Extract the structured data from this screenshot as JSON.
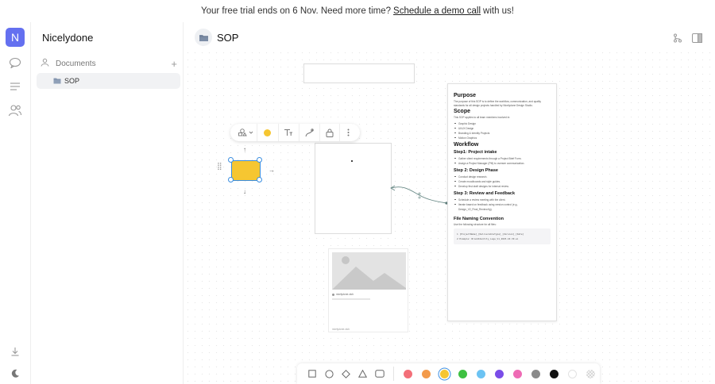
{
  "banner": {
    "prefix": "Your free trial ends on 6 Nov. Need more time?",
    "link": "Schedule a demo call",
    "suffix": "with us!"
  },
  "rail": {
    "logo_letter": "N",
    "icons": [
      "chat-icon",
      "menu-lines-icon",
      "people-icon",
      "download-icon",
      "moon-icon"
    ]
  },
  "sidebar": {
    "workspace_name": "Nicelydone",
    "section_label": "Documents",
    "items": [
      {
        "label": "SOP"
      }
    ]
  },
  "document": {
    "title": "SOP",
    "toolbar_icons": [
      "shapes-icon",
      "chevron-down-icon",
      "color-swatch",
      "text-format-icon",
      "connector-icon",
      "lock-icon",
      "more-vertical-icon"
    ]
  },
  "sop_card": {
    "purpose_heading": "Purpose",
    "purpose_text": "The purpose of this SOP is to define the workflow, communication, and quality standards for all design projects handled by Nicelydone Design Studio.",
    "scope_heading": "Scope",
    "scope_text": "This SOP applies to all team members involved in:",
    "scope_items": [
      "Graphic Design",
      "UI/UX Design",
      "Branding & Identity Projects",
      "Motion Graphics"
    ],
    "workflow_heading": "Workflow",
    "step1_heading": "Step1: Project intake",
    "step1_items": [
      "Gather client requirements through a Project Brief Form.",
      "Assign a Project Manager (PM) to oversee communication."
    ],
    "step2_heading": "Step 2: Design Phase",
    "step2_items": [
      "Conduct design research.",
      "Create moodboards and style guides.",
      "Develop first draft designs for internal review."
    ],
    "step3_heading": "Step 3: Review and Feedback",
    "step3_items": [
      "Schedule a review meeting with the client.",
      "Iterate based on feedback using version control (e.g., Design_V2_Final_Review.fig)."
    ],
    "naming_heading": "File Naming Convention",
    "naming_text": "Use the following structure for all files:",
    "code_lines": [
      "1   [ProjectName]_[DeliverableType]_[Version]_[Date]",
      "2   Example: BrandIdentity_Logo_V1_2025-10-30.ai"
    ]
  },
  "image_card": {
    "site": "nicelydone.club",
    "caption": "nicelydone.club"
  },
  "bottom_toolbar": {
    "tools": [
      "rectangle-tool-icon",
      "circle-tool-icon",
      "diamond-tool-icon",
      "triangle-tool-icon",
      "rounded-rect-tool-icon"
    ],
    "colors": [
      "#f36f79",
      "#f39a4a",
      "#f6c631",
      "#3ec041",
      "#6cc3f3",
      "#7a4de8",
      "#ee6bb5",
      "#8a8a8a",
      "#111111",
      "#ffffff",
      "#d8d8d8"
    ],
    "active_color": "#f6c631"
  }
}
